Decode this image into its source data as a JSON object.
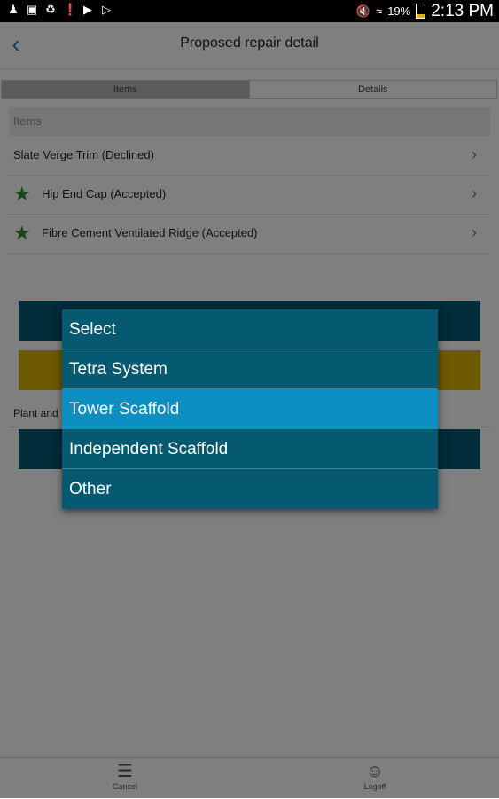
{
  "status_bar": {
    "battery": "19%",
    "time": "2:13 PM"
  },
  "header": {
    "title": "Proposed repair detail",
    "back_icon": "chevron-left-icon"
  },
  "tabs": [
    {
      "label": "Items",
      "active": true
    },
    {
      "label": "Details",
      "active": false
    }
  ],
  "items_section": {
    "heading": "Items",
    "items": [
      {
        "label": "Slate Verge Trim (Declined)",
        "starred": false
      },
      {
        "label": "Hip End Cap (Accepted)",
        "starred": true
      },
      {
        "label": "Fibre Cement Ventilated Ridge (Accepted)",
        "starred": true
      }
    ]
  },
  "plant_label": "Plant and",
  "dropdown": {
    "options": [
      "Select",
      "Tetra System",
      "Tower Scaffold",
      "Independent Scaffold",
      "Other"
    ],
    "selected": "Tower Scaffold"
  },
  "footer": {
    "cancel_label": "Cancel",
    "logoff_label": "Logoff"
  },
  "colors": {
    "accent_teal": "#055a71",
    "accent_gold": "#d8b300",
    "selected_option": "#0b8ec2",
    "star_green": "#2e8b3b"
  }
}
